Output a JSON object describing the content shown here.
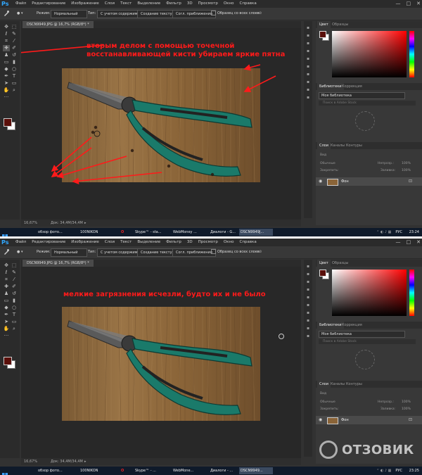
{
  "panels": [
    {
      "menu": [
        "Файл",
        "Редактирование",
        "Изображение",
        "Слои",
        "Текст",
        "Выделение",
        "Фильтр",
        "3D",
        "Просмотр",
        "Окно",
        "Справка"
      ],
      "options": {
        "mode_label": "Режим:",
        "mode_value": "Нормальный",
        "type_label": "Тип:",
        "type1": "С учетом содержимого",
        "type2": "Создание текстуры",
        "type3": "Согл. приближения",
        "sample_all": "Образец со всех слоев"
      },
      "tab_title": "DSCN9949.JPG @ 16,7% (RGB/8*) *",
      "status": {
        "zoom": "16,67%",
        "doc": "Док: 34,4M/34,4M"
      },
      "annotation": "вторым делом с помощью точечной\nвосстанавливающей кисти убираем яркие пятна",
      "right": {
        "color_tab": "Цвет",
        "swatches_tab": "Образцы",
        "library_tab": "Библиотеки",
        "corrections_tab": "Коррекция",
        "library_name": "Моя библиотека",
        "search_placeholder": "Поиск в Adobe Stock",
        "layers_tab": "Слои",
        "channels_tab": "Каналы",
        "paths_tab": "Контуры",
        "kind": "Вид",
        "normal": "Обычные",
        "opacity": "Непрозр.:",
        "opacity_val": "100%",
        "lock": "Закрепить:",
        "fill": "Заливка:",
        "fill_val": "100%",
        "layer_name": "Фон"
      },
      "taskbar": {
        "items": [
          "обзор фото...",
          "100NIKON",
          "",
          "Skype™ - sta...",
          "WebMoney ...",
          "Диалоги - G...",
          "DSCN9949J..."
        ],
        "lang": "РУС",
        "time": "23:24"
      }
    },
    {
      "menu": [
        "Файл",
        "Редактирование",
        "Изображение",
        "Слои",
        "Текст",
        "Выделение",
        "Фильтр",
        "3D",
        "Просмотр",
        "Окно",
        "Справка"
      ],
      "options": {
        "mode_label": "Режим:",
        "mode_value": "Нормальный",
        "type_label": "Тип:",
        "type1": "С учетом содержимого",
        "type2": "Создание текстуры",
        "type3": "Согл. приближения",
        "sample_all": "Образец со всех слоев"
      },
      "tab_title": "DSCN9949.JPG @ 16,7% (RGB/8*) *",
      "status": {
        "zoom": "16,67%",
        "doc": "Док: 34,4M/34,4M"
      },
      "annotation": "мелкие загрязнения исчезли, будто их и не было",
      "right": {
        "color_tab": "Цвет",
        "swatches_tab": "Образцы",
        "library_tab": "Библиотеки",
        "corrections_tab": "Коррекция",
        "library_name": "Моя библиотека",
        "search_placeholder": "Поиск в Adobe Stock",
        "layers_tab": "Слои",
        "channels_tab": "Каналы",
        "paths_tab": "Контуры",
        "kind": "Вид",
        "normal": "Обычные",
        "opacity": "Непрозр.:",
        "opacity_val": "100%",
        "lock": "Закрепить:",
        "fill": "Заливка:",
        "fill_val": "100%",
        "layer_name": "Фон"
      },
      "taskbar": {
        "items": [
          "обзор фото...",
          "100NIKON",
          "",
          "Skype™ - ...",
          "WebMone...",
          "Диалоги - ...",
          "DSCN9949..."
        ],
        "lang": "РУС",
        "time": "23:25"
      }
    }
  ],
  "watermark": "ОТЗОВИК",
  "colors": {
    "foreground": "#5a0f0a",
    "annotation": "#ff1a1a",
    "accent": "#31a8ff"
  }
}
